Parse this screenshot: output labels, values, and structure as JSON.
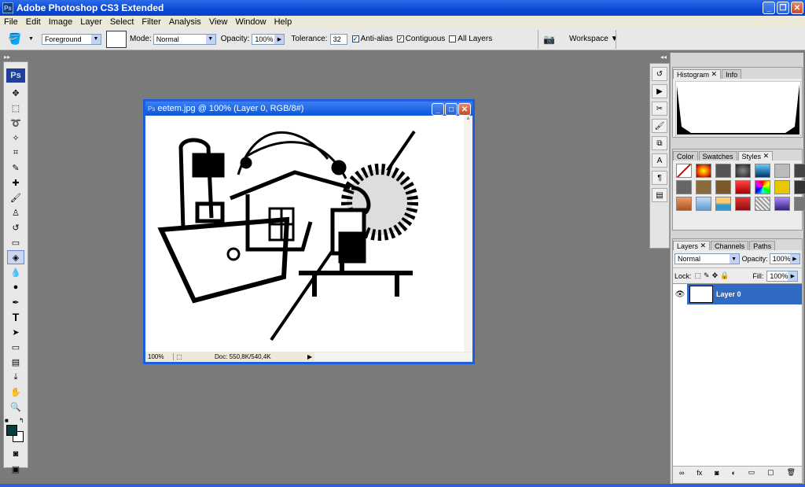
{
  "app": {
    "title": "Adobe Photoshop CS3 Extended",
    "ps_icon": "Ps"
  },
  "menu": [
    "File",
    "Edit",
    "Image",
    "Layer",
    "Select",
    "Filter",
    "Analysis",
    "View",
    "Window",
    "Help"
  ],
  "options": {
    "fill_source": "Foreground",
    "mode_label": "Mode:",
    "mode_value": "Normal",
    "opacity_label": "Opacity:",
    "opacity_value": "100%",
    "tolerance_label": "Tolerance:",
    "tolerance_value": "32",
    "antialias": "Anti-alias",
    "contiguous": "Contiguous",
    "all_layers": "All Layers",
    "workspace": "Workspace"
  },
  "toolbox": {
    "logo": "Ps"
  },
  "document": {
    "title": "eetem.jpg @ 100% (Layer 0, RGB/8#)",
    "zoom": "100%",
    "doc_info": "Doc: 550,8K/540,4K"
  },
  "panels": {
    "histogram_tabs": [
      "Histogram",
      "Info"
    ],
    "color_tabs": [
      "Color",
      "Swatches",
      "Styles"
    ],
    "layers_tabs": [
      "Layers",
      "Channels",
      "Paths"
    ],
    "blend_mode": "Normal",
    "opacity_label": "Opacity:",
    "opacity_value": "100%",
    "lock_label": "Lock:",
    "fill_label": "Fill:",
    "fill_value": "100%",
    "layer_name": "Layer 0"
  },
  "colors": {
    "accent": "#316ac5",
    "title_blue": "#0a47d6",
    "fg": "#0d3a3a"
  }
}
